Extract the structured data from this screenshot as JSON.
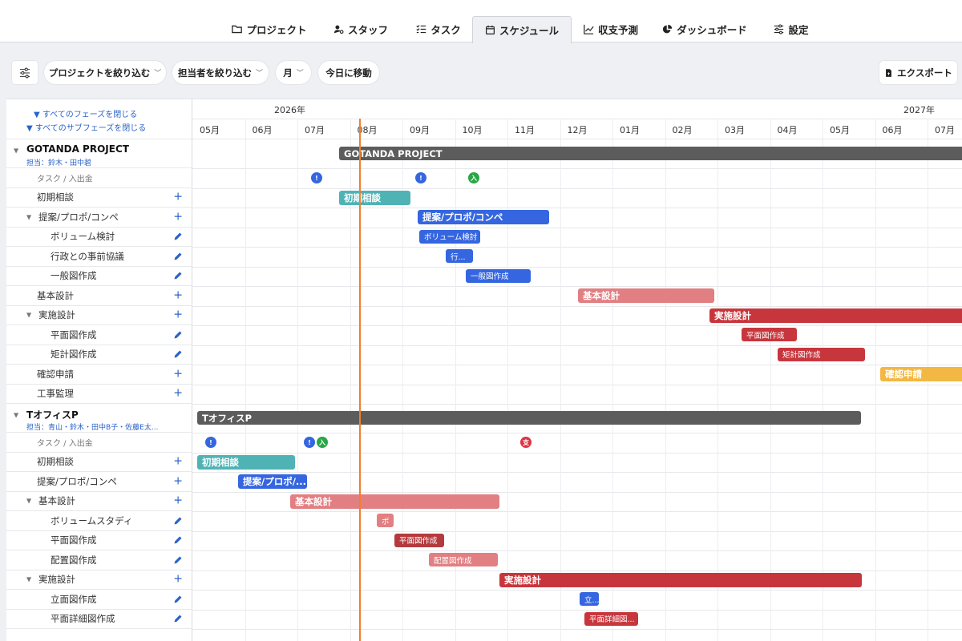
{
  "nav": {
    "tabs": [
      {
        "label": "プロジェクト",
        "icon": "folder-icon"
      },
      {
        "label": "スタッフ",
        "icon": "user-gear-icon"
      },
      {
        "label": "タスク",
        "icon": "checklist-icon"
      },
      {
        "label": "スケジュール",
        "icon": "calendar-icon",
        "active": true
      },
      {
        "label": "収支予測",
        "icon": "line-chart-icon"
      },
      {
        "label": "ダッシュボード",
        "icon": "pie-chart-icon"
      },
      {
        "label": "設定",
        "icon": "sliders-icon"
      }
    ]
  },
  "toolbar": {
    "filter_project": "プロジェクトを絞り込む",
    "filter_staff": "担当者を絞り込む",
    "period": "月",
    "goto_today": "今日に移動",
    "export": "エクスポート"
  },
  "left": {
    "collapse_phases": "▼ すべてのフェーズを閉じる",
    "collapse_subphases": "▼ すべてのサブフェーズを閉じる"
  },
  "timeline": {
    "years": [
      "2026年",
      "2027年"
    ],
    "months": [
      "05月",
      "06月",
      "07月",
      "08月",
      "09月",
      "10月",
      "11月",
      "12月",
      "01月",
      "02月",
      "03月",
      "04月",
      "05月",
      "06月",
      "07月"
    ]
  },
  "colors": {
    "project": "#5c5c5c",
    "initial": "#4fb3b5",
    "proposal": "#3566e0",
    "basic": "#e17f82",
    "basic_dark": "#b43a3d",
    "detail": "#c8363d",
    "confirm": "#f2b843",
    "today": "#f0802c"
  },
  "projects": [
    {
      "title": "GOTANDA PROJECT",
      "staff": "担当：鈴木・田中碧",
      "task_label": "タスク / 入出金",
      "rows": [
        {
          "label": "初期相談",
          "level": 1,
          "action": "plus"
        },
        {
          "label": "提案/プロポ/コンペ",
          "level": 1,
          "action": "plus",
          "caret": true
        },
        {
          "label": "ボリューム検討",
          "level": 2,
          "action": "edit"
        },
        {
          "label": "行政との事前協議",
          "level": 2,
          "action": "edit"
        },
        {
          "label": "一般図作成",
          "level": 2,
          "action": "edit"
        },
        {
          "label": "基本設計",
          "level": 1,
          "action": "plus"
        },
        {
          "label": "実施設計",
          "level": 1,
          "action": "plus",
          "caret": true
        },
        {
          "label": "平面図作成",
          "level": 2,
          "action": "edit"
        },
        {
          "label": "矩計図作成",
          "level": 2,
          "action": "edit"
        },
        {
          "label": "確認申請",
          "level": 1,
          "action": "plus"
        },
        {
          "label": "工事監理",
          "level": 1,
          "action": "plus"
        }
      ],
      "bars": [
        {
          "label": "GOTANDA PROJECT",
          "color": "project"
        },
        {
          "label": "初期相談",
          "color": "initial"
        },
        {
          "label": "提案/プロポ/コンペ",
          "color": "proposal"
        },
        {
          "label": "ボリューム検討",
          "color": "proposal"
        },
        {
          "label": "行...",
          "color": "proposal"
        },
        {
          "label": "一般図作成",
          "color": "proposal"
        },
        {
          "label": "基本設計",
          "color": "basic"
        },
        {
          "label": "実施設計",
          "color": "detail"
        },
        {
          "label": "平面図作成",
          "color": "detail"
        },
        {
          "label": "矩計図作成",
          "color": "detail"
        },
        {
          "label": "確認申請",
          "color": "confirm"
        }
      ],
      "markers": [
        {
          "glyph": "!",
          "color": "#3566e0"
        },
        {
          "glyph": "!",
          "color": "#3566e0"
        },
        {
          "glyph": "入",
          "color": "#28a745"
        }
      ]
    },
    {
      "title": "TオフィスP",
      "staff": "担当：青山・鈴木・田中B子・佐藤E太...",
      "task_label": "タスク / 入出金",
      "rows": [
        {
          "label": "初期相談",
          "level": 1,
          "action": "plus"
        },
        {
          "label": "提案/プロポ/コンペ",
          "level": 1,
          "action": "plus"
        },
        {
          "label": "基本設計",
          "level": 1,
          "action": "plus",
          "caret": true
        },
        {
          "label": "ボリュームスタディ",
          "level": 2,
          "action": "edit"
        },
        {
          "label": "平面図作成",
          "level": 2,
          "action": "edit"
        },
        {
          "label": "配置図作成",
          "level": 2,
          "action": "edit"
        },
        {
          "label": "実施設計",
          "level": 1,
          "action": "plus",
          "caret": true
        },
        {
          "label": "立面図作成",
          "level": 2,
          "action": "edit"
        },
        {
          "label": "平面詳細図作成",
          "level": 2,
          "action": "edit"
        }
      ],
      "bars": [
        {
          "label": "TオフィスP",
          "color": "project"
        },
        {
          "label": "初期相談",
          "color": "initial"
        },
        {
          "label": "提案/プロポ/...",
          "color": "proposal"
        },
        {
          "label": "基本設計",
          "color": "basic"
        },
        {
          "label": "ボ",
          "color": "basic"
        },
        {
          "label": "平面図作成",
          "color": "basic_dark"
        },
        {
          "label": "配置図作成",
          "color": "basic"
        },
        {
          "label": "実施設計",
          "color": "detail"
        },
        {
          "label": "立...",
          "color": "proposal"
        },
        {
          "label": "平面詳細図...",
          "color": "detail"
        }
      ],
      "markers": [
        {
          "glyph": "!",
          "color": "#3566e0"
        },
        {
          "glyph": "!",
          "color": "#3566e0"
        },
        {
          "glyph": "入",
          "color": "#28a745"
        },
        {
          "glyph": "支",
          "color": "#dc3545"
        }
      ]
    }
  ]
}
